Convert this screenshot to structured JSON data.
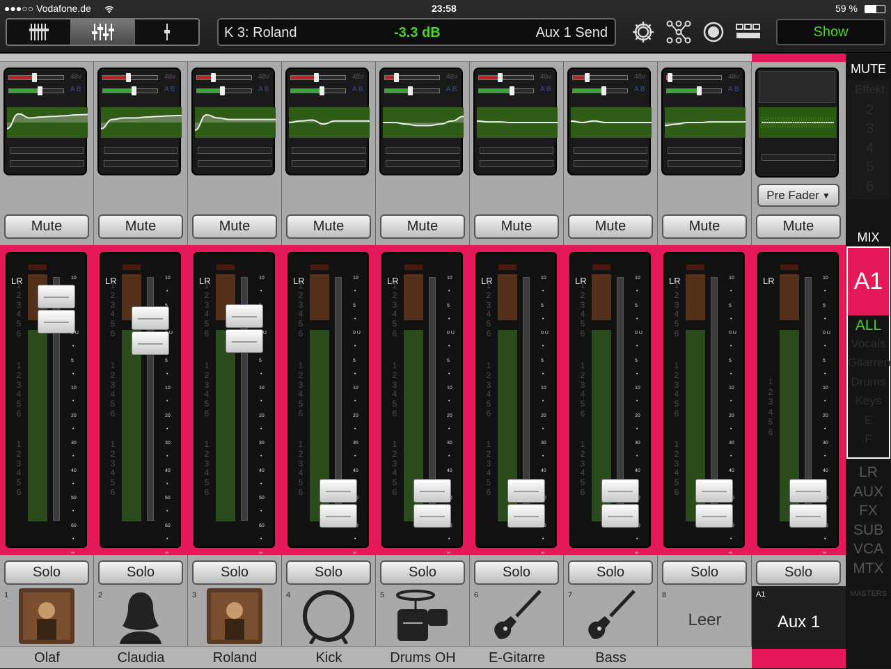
{
  "status_bar": {
    "carrier": "●●●○○ Vodafone.de",
    "time": "23:58",
    "battery": "59 %"
  },
  "info": {
    "channel": "K 3: Roland",
    "value": "-3.3 dB",
    "mode": "Aux 1 Send"
  },
  "show_label": "Show",
  "channel_strips": [
    {
      "number": "1",
      "name": "Olaf",
      "icon": "photo-icon",
      "gain_red": 0.45,
      "gain_green": 0.55,
      "fader_level": 0.86,
      "eq": [
        0.7,
        0.22,
        0.35,
        0.32,
        0.3,
        0.28,
        0.25,
        0.24
      ]
    },
    {
      "number": "2",
      "name": "Claudia",
      "icon": "person-silhouette-icon",
      "gain_red": 0.45,
      "gain_green": 0.55,
      "fader_level": 0.77,
      "eq": [
        0.7,
        0.4,
        0.35,
        0.35,
        0.32,
        0.3,
        0.28,
        0.27
      ]
    },
    {
      "number": "3",
      "name": "Roland",
      "icon": "photo-icon",
      "gain_red": 0.28,
      "gain_green": 0.45,
      "fader_level": 0.78,
      "eq": [
        0.75,
        0.25,
        0.35,
        0.4,
        0.4,
        0.4,
        0.4,
        0.4
      ]
    },
    {
      "number": "4",
      "name": "Kick",
      "icon": "drum-icon",
      "gain_red": 0.45,
      "gain_green": 0.55,
      "fader_level": 0.05,
      "eq": [
        0.5,
        0.45,
        0.42,
        0.55,
        0.45,
        0.45,
        0.45,
        0.45
      ]
    },
    {
      "number": "5",
      "name": "Drums OH",
      "icon": "drumkit-icon",
      "gain_red": 0.2,
      "gain_green": 0.45,
      "fader_level": 0.05,
      "eq": [
        0.5,
        0.5,
        0.55,
        0.6,
        0.6,
        0.55,
        0.45,
        0.3
      ]
    },
    {
      "number": "6",
      "name": "E-Gitarre",
      "icon": "electric-guitar-icon",
      "gain_red": 0.37,
      "gain_green": 0.6,
      "fader_level": 0.05,
      "eq": [
        0.45,
        0.48,
        0.48,
        0.5,
        0.5,
        0.5,
        0.5,
        0.5
      ]
    },
    {
      "number": "7",
      "name": "Bass",
      "icon": "bass-guitar-icon",
      "gain_red": 0.25,
      "gain_green": 0.55,
      "fader_level": 0.05,
      "eq": [
        0.45,
        0.5,
        0.45,
        0.5,
        0.5,
        0.5,
        0.5,
        0.5
      ]
    },
    {
      "number": "8",
      "name": "",
      "empty_label": "Leer",
      "icon": "",
      "gain_red": 0.04,
      "gain_green": 0.58,
      "fader_level": 0.05,
      "eq": [
        0.6,
        0.55,
        0.5,
        0.5,
        0.48,
        0.48,
        0.48,
        0.48
      ]
    }
  ],
  "strip_labels": {
    "mute": "Mute",
    "solo": "Solo",
    "lr": "LR",
    "phantom": "48v",
    "ab": "A B"
  },
  "meter_numbers": [
    "1",
    "2",
    "3",
    "4",
    "5",
    "6"
  ],
  "fader_ticks": [
    "10",
    "5",
    "0 U",
    "5",
    "10",
    "20",
    "30",
    "40",
    "50",
    "60",
    "∞"
  ],
  "aux": {
    "pre_fader_label": "Pre Fader",
    "tag": "A1",
    "name": "Aux 1",
    "fader_level": 0.05
  },
  "right_panel": {
    "mute_header": "MUTE",
    "mute_groups": [
      "Effekt",
      "2",
      "3",
      "4",
      "5",
      "6"
    ],
    "mix_header": "MIX",
    "mix_active": "A1",
    "mix_groups": [
      "ALL",
      "Vocals",
      "Gitarren",
      "Drums",
      "Keys",
      "E",
      "F"
    ],
    "bus_types": [
      "LR",
      "AUX",
      "FX",
      "SUB",
      "VCA",
      "MTX"
    ],
    "masters_label": "MASTERS"
  },
  "colors": {
    "accent": "#e5195a",
    "green": "#4ed32b",
    "meter_green": "#2b4b1c"
  }
}
